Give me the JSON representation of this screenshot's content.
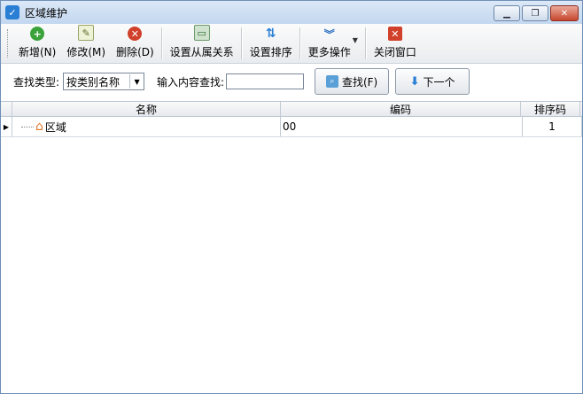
{
  "window": {
    "title": "区域维护",
    "controls": {
      "minimize": "▁",
      "restore": "❐",
      "close": "✕"
    }
  },
  "toolbar": {
    "add": "新增(N)",
    "edit": "修改(M)",
    "delete": "删除(D)",
    "set_relation": "设置从属关系",
    "set_order": "设置排序",
    "more": "更多操作",
    "close_window": "关闭窗口"
  },
  "search": {
    "type_label": "查找类型:",
    "type_value": "按类别名称",
    "content_label": "输入内容查找:",
    "content_value": "",
    "find_button": "查找(F)",
    "next_button": "下一个"
  },
  "grid": {
    "columns": [
      "名称",
      "编码",
      "排序码"
    ],
    "rows": [
      {
        "name": "区域",
        "code": "00",
        "order": "1"
      }
    ]
  },
  "colors": {
    "add_icon": "#3aa23a",
    "delete_icon": "#d0402a",
    "close_icon": "#d0402a",
    "accent": "#2a7fd4",
    "home_icon": "#e0752a"
  }
}
